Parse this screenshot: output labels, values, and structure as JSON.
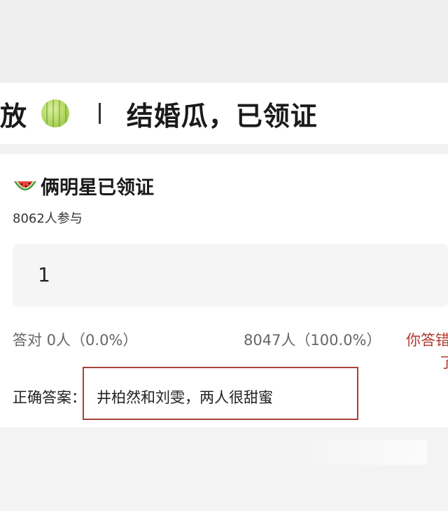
{
  "header": {
    "title_left": "放",
    "title_right": "结婚瓜，已领证",
    "title_icon": "melon-icon"
  },
  "question": {
    "title": "俩明星已领证",
    "icon": "watermelon-slice-icon",
    "participants": "8062人参与",
    "option_value": "1"
  },
  "stats": {
    "correct": "答对  0人（0.0%）",
    "wrong": "8047人（100.0%）",
    "your_answer_line1": "你答错",
    "your_answer_line2": "了"
  },
  "answer": {
    "label": "正确答案：",
    "value": "井柏然和刘雯，两人很甜蜜"
  },
  "colors": {
    "accent_red": "#b23a2e",
    "highlight_box": "#a9403d"
  }
}
